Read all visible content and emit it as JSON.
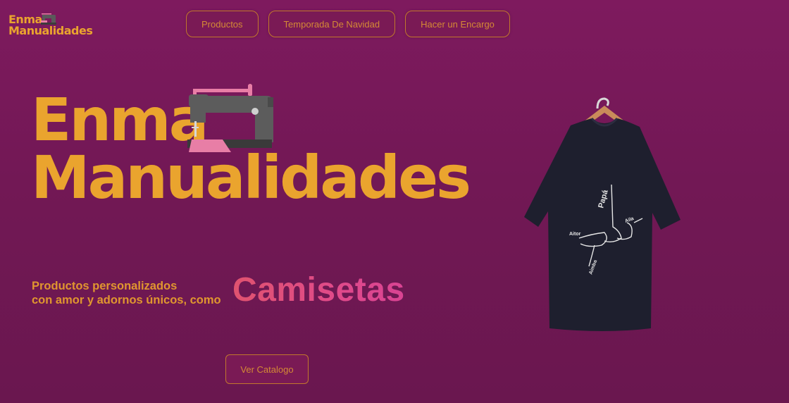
{
  "brand": {
    "line1": "Enma",
    "line2": "Manualidades"
  },
  "nav": {
    "items": [
      {
        "label": "Productos"
      },
      {
        "label": "Temporada De Navidad"
      },
      {
        "label": "Hacer un Encargo"
      }
    ]
  },
  "hero": {
    "title_line1": "Enma",
    "title_line2": "Manualidades",
    "tagline_line1": "Productos personalizados",
    "tagline_line2": "con amor y adornos únicos, como",
    "highlight_word": "Camisetas",
    "cta_label": "Ver Catalogo"
  },
  "shirt_print": {
    "top": "Papá",
    "left": "Aitor",
    "right": "Aila",
    "bottom": "Aimba"
  },
  "colors": {
    "background": "#741856",
    "accent": "#eaa42e",
    "button_border": "#c2772c",
    "highlight": "#e0508a"
  },
  "icons": {
    "logo": "sewing-machine-icon",
    "hero_illustration": "sewing-machine-icon",
    "product": "t-shirt-image"
  }
}
